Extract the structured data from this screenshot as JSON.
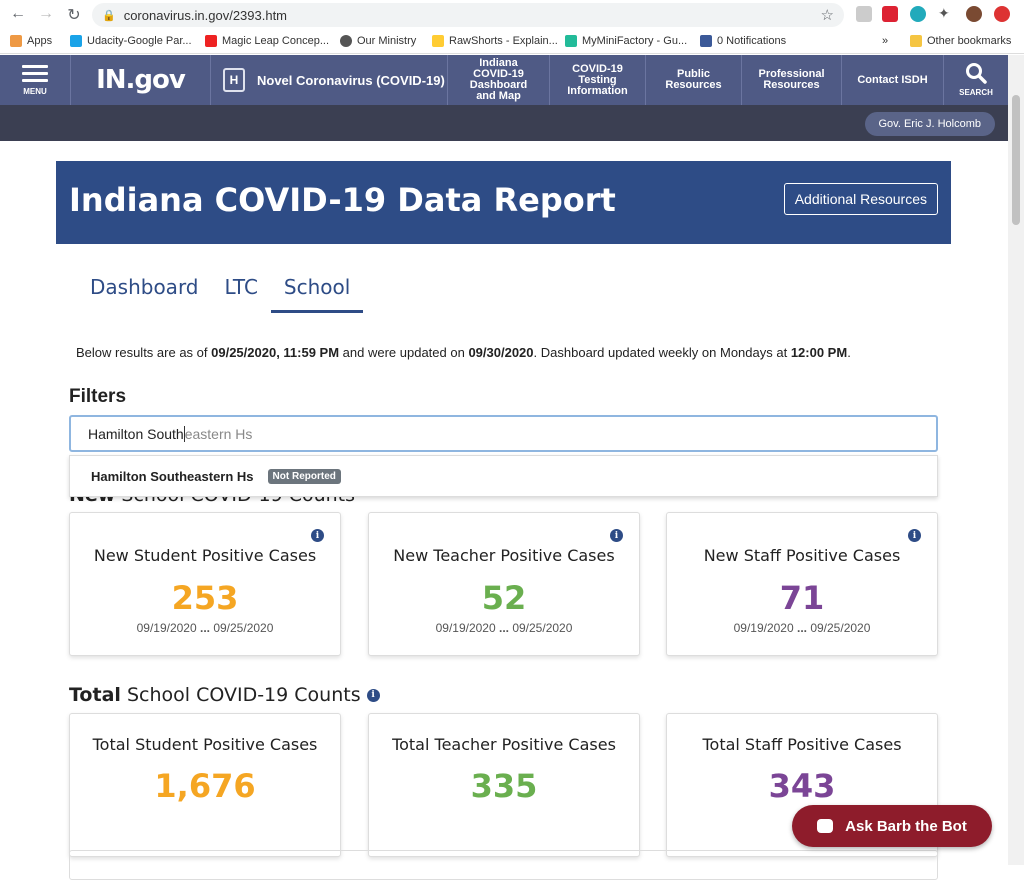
{
  "browser": {
    "url": "coronavirus.in.gov/2393.htm",
    "bookmarks": [
      "Apps",
      "Udacity-Google Par...",
      "Magic Leap Concep...",
      "Our Ministry",
      "RawShorts - Explain...",
      "MyMiniFactory - Gu...",
      "0 Notifications"
    ],
    "overflow": "»",
    "other_bookmarks": "Other bookmarks"
  },
  "site_header": {
    "menu_label": "MENU",
    "logo": "IN.gov",
    "section": "Novel Coronavirus (COVID-19)",
    "nav": [
      "Indiana COVID-19 Dashboard and Map",
      "COVID-19 Testing Information",
      "Public Resources",
      "Professional Resources",
      "Contact ISDH"
    ],
    "search_label": "SEARCH",
    "governor": "Gov. Eric J. Holcomb"
  },
  "banner": {
    "title": "Indiana COVID-19 Data Report",
    "button": "Additional Resources"
  },
  "tabs": [
    "Dashboard",
    "LTC",
    "School"
  ],
  "active_tab": "School",
  "asof": {
    "p1": "Below results are as of ",
    "date1": "09/25/2020, 11:59 PM",
    "p2": " and were updated on ",
    "date2": "09/30/2020",
    "p3": ". Dashboard updated weekly on Mondays at ",
    "time": "12:00 PM",
    "p4": "."
  },
  "filters": {
    "title": "Filters",
    "typed": "Hamilton South",
    "suggestion": "eastern Hs",
    "dropdown_item": "Hamilton Southeastern Hs",
    "dropdown_badge": "Not Reported"
  },
  "new_section": {
    "title_bold": "New",
    "title_rest": " School COVID-19 Counts",
    "cards": [
      {
        "title": "New Student Positive Cases",
        "value": "253",
        "range_start": "09/19/2020",
        "range_sep": " ... ",
        "range_end": "09/25/2020",
        "color": "#f5a623"
      },
      {
        "title": "New Teacher Positive Cases",
        "value": "52",
        "range_start": "09/19/2020",
        "range_sep": " ... ",
        "range_end": "09/25/2020",
        "color": "#6aaf4f"
      },
      {
        "title": "New Staff Positive Cases",
        "value": "71",
        "range_start": "09/19/2020",
        "range_sep": " ... ",
        "range_end": "09/25/2020",
        "color": "#7b4596"
      }
    ]
  },
  "total_section": {
    "title_bold": "Total",
    "title_rest": " School COVID-19 Counts",
    "cards": [
      {
        "title": "Total Student Positive Cases",
        "value": "1,676",
        "color": "#f5a623"
      },
      {
        "title": "Total Teacher Positive Cases",
        "value": "335",
        "color": "#6aaf4f"
      },
      {
        "title": "Total Staff Positive Cases",
        "value": "343",
        "color": "#7b4596"
      }
    ]
  },
  "bot": {
    "label": "Ask Barb the Bot"
  },
  "icons": {
    "info": "i"
  }
}
